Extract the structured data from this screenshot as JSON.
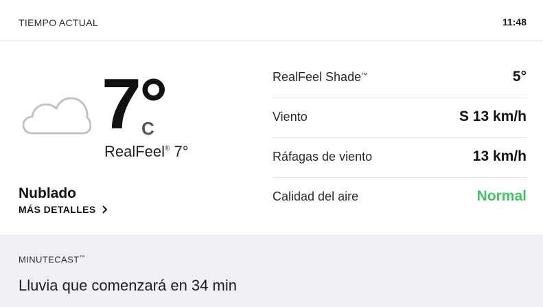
{
  "header": {
    "title": "TIEMPO ACTUAL",
    "time": "11:48"
  },
  "current": {
    "icon": "cloud-icon",
    "temperature": "7°",
    "unit": "C",
    "realfeel_label": "RealFeel",
    "realfeel_mark": "®",
    "realfeel_value": "7°",
    "condition": "Nublado",
    "more_details": "MÁS DETALLES"
  },
  "details": [
    {
      "label": "RealFeel Shade",
      "mark": "™",
      "value": "5°"
    },
    {
      "label": "Viento",
      "mark": "",
      "value": "S 13 km/h"
    },
    {
      "label": "Ráfagas de viento",
      "mark": "",
      "value": "13 km/h"
    },
    {
      "label": "Calidad del aire",
      "mark": "",
      "value": "Normal"
    }
  ],
  "minutecast": {
    "title": "MINUTECAST",
    "mark": "™",
    "text": "Lluvia que comenzará en 34 min"
  },
  "colors": {
    "air_quality_good": "#41c464",
    "minutecast_background": "#eef0f3"
  }
}
